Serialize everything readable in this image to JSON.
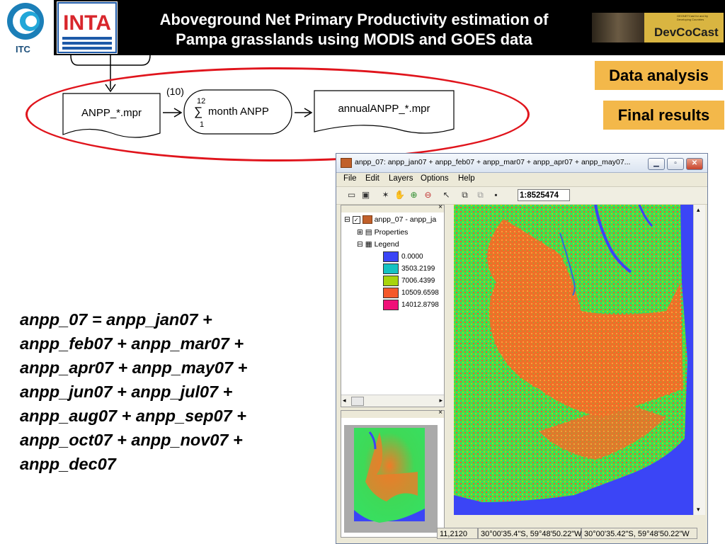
{
  "header": {
    "title_line1": "Aboveground Net Primary Productivity estimation of",
    "title_line2": "Pampa grasslands using MODIS and GOES data",
    "itc_logo_text": "ITC",
    "inta_logo_text": "INTA",
    "devcocast_name": "DevCoCast",
    "devcocast_small": "GEONETCast for and by Developing Countries"
  },
  "tags": {
    "data_analysis": "Data analysis",
    "final_results": "Final results"
  },
  "flow": {
    "step_number": "(10)",
    "input_file": "ANPP_*.mpr",
    "sum_upper": "12",
    "sum_lower": "1",
    "sum_symbol": "∑",
    "process": "month ANPP",
    "output_file": "annualANPP_*.mpr"
  },
  "formula": [
    "anpp_07 = anpp_jan07 +",
    "anpp_feb07 + anpp_mar07 +",
    "anpp_apr07 + anpp_may07 +",
    "anpp_jun07 + anpp_jul07 +",
    "anpp_aug07 + anpp_sep07 +",
    "anpp_oct07 + anpp_nov07 +",
    "anpp_dec07"
  ],
  "window": {
    "title": "anpp_07: anpp_jan07 + anpp_feb07 + anpp_mar07 + anpp_apr07 + anpp_may07...",
    "menu": [
      "File",
      "Edit",
      "Layers",
      "Options",
      "Help"
    ],
    "scale": "1:8525474",
    "tree": {
      "layer": "anpp_07 - anpp_ja",
      "properties": "Properties",
      "legend": "Legend"
    },
    "legend_items": [
      {
        "value": "0.0000",
        "color": "#3b45f6"
      },
      {
        "value": "3503.2199",
        "color": "#15c2c2"
      },
      {
        "value": "7006.4399",
        "color": "#a8d40c"
      },
      {
        "value": "10509.6598",
        "color": "#f4582a"
      },
      {
        "value": "14012.8798",
        "color": "#f01078"
      }
    ],
    "status": {
      "rowcol": "11,2120",
      "coord1": "30°00'35.4\"S, 59°48'50.22\"W",
      "coord2": "30°00'35.42\"S, 59°48'50.22\"W"
    }
  },
  "colors": {
    "accent_tag": "#f3b84a",
    "ellipse": "#e0141c",
    "map_water": "#3b45f6",
    "map_green": "#39e65a",
    "map_orange": "#f07a28"
  }
}
